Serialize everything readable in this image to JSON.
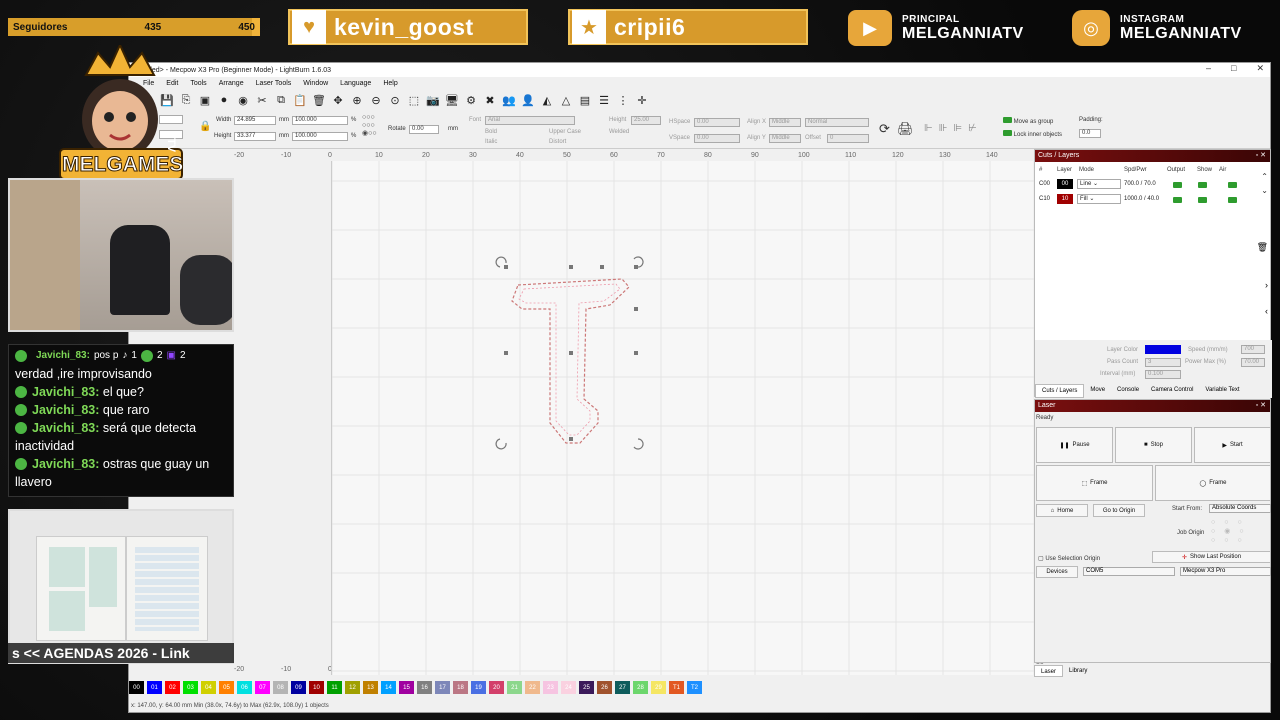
{
  "overlay": {
    "followers_label": "Seguidores",
    "followers_current": "435",
    "followers_goal": "450",
    "followers_fraction": 0.967,
    "tag1": "kevin_goost",
    "tag2": "cripii6",
    "youtube_label": "PRINCIPAL",
    "youtube_name": "MELGANNIATV",
    "instagram_label": "INSTAGRAM",
    "instagram_name": "MELGANNIATV",
    "logo_text": "MELGAMES",
    "logo_tv": "TV",
    "chat_counts": [
      "1",
      "2",
      "2"
    ],
    "chat": [
      {
        "user": "Javichi_83:",
        "msg": "pos p"
      },
      {
        "user": "",
        "msg": "verdad ,ire improvisando"
      },
      {
        "user": "Javichi_83:",
        "msg": "el que?"
      },
      {
        "user": "Javichi_83:",
        "msg": "que raro"
      },
      {
        "user": "Javichi_83:",
        "msg": "será que detecta inactividad"
      },
      {
        "user": "Javichi_83:",
        "msg": "ostras que guay un llavero"
      }
    ],
    "ticker": "s << AGENDAS 2026 - Link"
  },
  "app": {
    "title": "<untitled> - Mecpow X3 Pro (Beginner Mode) - LightBurn 1.6.03",
    "menu": [
      "File",
      "Edit",
      "Tools",
      "Arrange",
      "Laser Tools",
      "Window",
      "Language",
      "Help"
    ],
    "width_label": "Width",
    "width_value": "24.895",
    "height_label": "Height",
    "height_value": "33.377",
    "unit": "mm",
    "pct_w": "100.000",
    "pct_h": "100.000",
    "pct": "%",
    "rotate_label": "Rotate",
    "rotate_value": "0.00",
    "font_label": "Font",
    "font_value": "Arial",
    "text_height_label": "Height",
    "text_height_value": "25.00",
    "hspace_label": "HSpace",
    "hspace_value": "0.00",
    "vspace_label": "VSpace",
    "vspace_value": "0.00",
    "alignx_label": "Align X",
    "alignx_value": "Middle",
    "aligny_label": "Align Y",
    "aligny_value": "Middle",
    "normal_value": "Normal",
    "offset_label": "Offset",
    "offset_value": "0",
    "bold": "Bold",
    "italic": "Italic",
    "upper_case": "Upper Case",
    "distort": "Distort",
    "welded": "Welded",
    "move_as_group": "Move as group",
    "lock_inner": "Lock inner objects",
    "padding_label": "Padding:",
    "padding_value": "0.0",
    "ruler_x": [
      "-20",
      "-10",
      "0",
      "10",
      "20",
      "30",
      "40",
      "50",
      "60",
      "70",
      "80",
      "90",
      "100",
      "110",
      "120",
      "130",
      "140"
    ],
    "ruler_y": [
      "130",
      "120",
      "110",
      "100",
      "90",
      "80",
      "70",
      "60",
      "50",
      "40",
      "30"
    ],
    "palette": [
      {
        "label": "00",
        "color": "#000000"
      },
      {
        "label": "01",
        "color": "#0000ff"
      },
      {
        "label": "02",
        "color": "#ff0000"
      },
      {
        "label": "03",
        "color": "#00e000"
      },
      {
        "label": "04",
        "color": "#d0d000"
      },
      {
        "label": "05",
        "color": "#ff8000"
      },
      {
        "label": "06",
        "color": "#00e0e0"
      },
      {
        "label": "07",
        "color": "#ff00ff"
      },
      {
        "label": "08",
        "color": "#b4b4b4"
      },
      {
        "label": "09",
        "color": "#0000a0"
      },
      {
        "label": "10",
        "color": "#a00000"
      },
      {
        "label": "11",
        "color": "#00a000"
      },
      {
        "label": "12",
        "color": "#a0a000"
      },
      {
        "label": "13",
        "color": "#c08000"
      },
      {
        "label": "14",
        "color": "#00a0ff"
      },
      {
        "label": "15",
        "color": "#a000a0"
      },
      {
        "label": "16",
        "color": "#808080"
      },
      {
        "label": "17",
        "color": "#7d87b9"
      },
      {
        "label": "18",
        "color": "#bb7784"
      },
      {
        "label": "19",
        "color": "#4a6fe3"
      },
      {
        "label": "20",
        "color": "#d33f6a"
      },
      {
        "label": "21",
        "color": "#8cd78c"
      },
      {
        "label": "22",
        "color": "#f0b98d"
      },
      {
        "label": "23",
        "color": "#f6c4e1"
      },
      {
        "label": "24",
        "color": "#fad1e0"
      },
      {
        "label": "25",
        "color": "#3b1a5a"
      },
      {
        "label": "26",
        "color": "#a0522d"
      },
      {
        "label": "27",
        "color": "#0e5c5c"
      },
      {
        "label": "28",
        "color": "#6cd66c"
      },
      {
        "label": "29",
        "color": "#f5e663"
      },
      {
        "label": "T1",
        "color": "#e25822"
      },
      {
        "label": "T2",
        "color": "#1e90ff"
      }
    ],
    "status": "x: 147.00, y: 64.00 mm     Min (38.0x, 74.6y) to Max (62.9x, 108.0y)  1 objects",
    "cuts": {
      "title": "Cuts / Layers",
      "headers": [
        "#",
        "Layer",
        "Mode",
        "Spd/Pwr",
        "Output",
        "Show",
        "Air"
      ],
      "rows": [
        {
          "num": "C00",
          "layer": "00",
          "color": "#000000",
          "mode": "Line",
          "spd": "700.0 / 70.0"
        },
        {
          "num": "C10",
          "layer": "10",
          "color": "#a00000",
          "mode": "Fill",
          "spd": "1000.0 / 40.0"
        }
      ],
      "layer_color": "Layer Color",
      "speed_label": "Speed (mm/m)",
      "speed_value": "700",
      "pass_label": "Pass Count",
      "pass_value": "3",
      "power_label": "Power Max (%)",
      "power_value": "70.00",
      "interval_label": "Interval (mm)",
      "interval_value": "0.100",
      "tabs": [
        "Cuts / Layers",
        "Move",
        "Console",
        "Camera Control",
        "Variable Text"
      ]
    },
    "laser": {
      "title": "Laser",
      "state": "Ready",
      "pause": "Pause",
      "stop": "Stop",
      "start": "Start",
      "frame1": "Frame",
      "frame2": "Frame",
      "home": "Home",
      "go_origin": "Go to Origin",
      "start_from_label": "Start From:",
      "start_from_value": "Absolute Coords",
      "job_origin": "Job Origin",
      "use_sel_origin": "Use Selection Origin",
      "show_last": "Show Last Position",
      "devices": "Devices",
      "port": "COM5",
      "device": "Mecpow X3 Pro",
      "tabs": [
        "Laser",
        "Library"
      ]
    }
  }
}
